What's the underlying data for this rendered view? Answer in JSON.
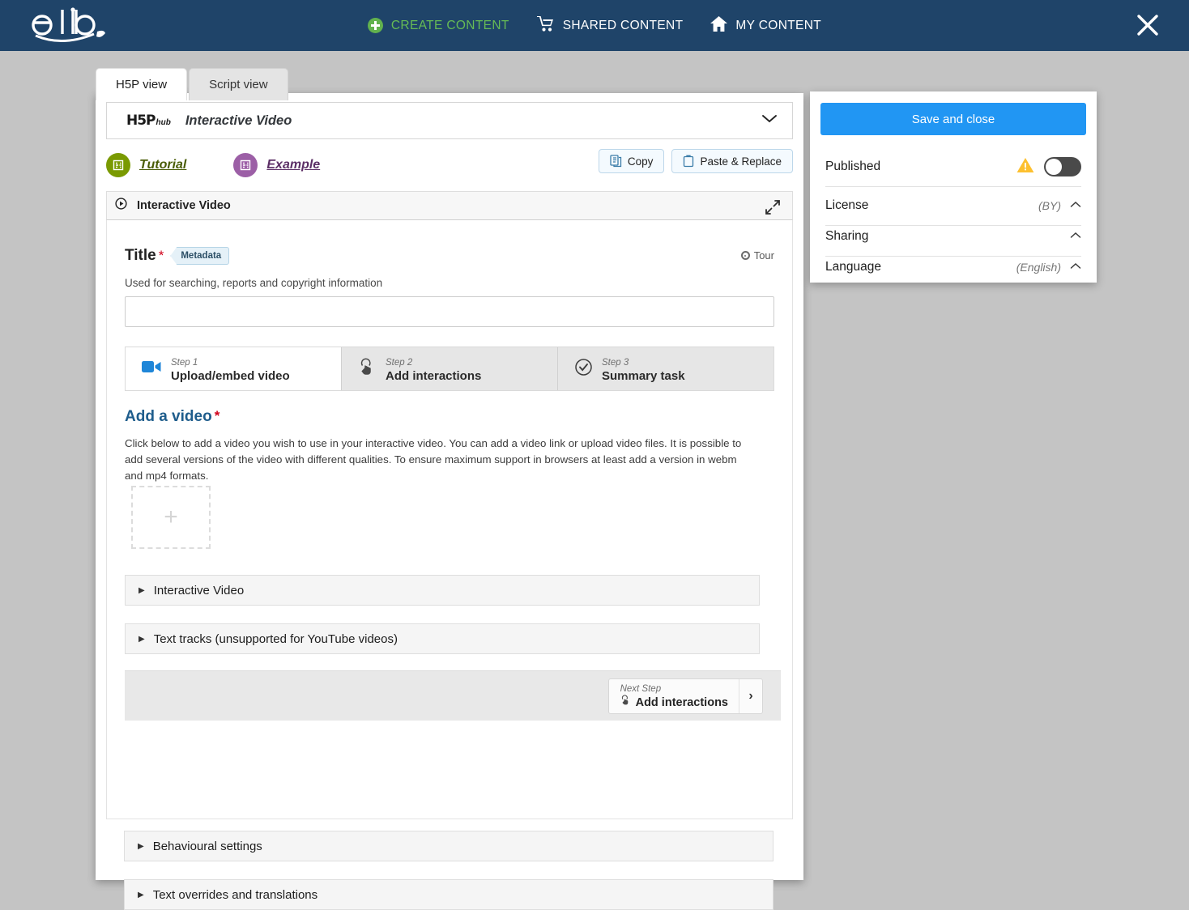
{
  "topbar": {
    "logo_text": "edlib",
    "nav": [
      {
        "label": "CREATE CONTENT",
        "icon": "plus-circle-icon"
      },
      {
        "label": "SHARED CONTENT",
        "icon": "shopping-cart-icon"
      },
      {
        "label": "MY CONTENT",
        "icon": "home-icon"
      }
    ],
    "close_label": "close-icon"
  },
  "tabs": [
    {
      "label": "H5P view",
      "active": true
    },
    {
      "label": "Script view",
      "active": false
    }
  ],
  "hub": {
    "logo_mark": "H5P",
    "logo_sub": "hub",
    "content_type": "Interactive Video",
    "chevron": "chevron-down-icon"
  },
  "links": [
    {
      "label": "Tutorial",
      "badge": "EQ·BE"
    },
    {
      "label": "Example",
      "badge": "EQ·3D"
    }
  ],
  "clipboard": {
    "copy_label": "Copy",
    "paste_label": "Paste & Replace"
  },
  "editor_header": {
    "title": "Interactive Video",
    "expand_icon": "expand-arrows-icon"
  },
  "title_field": {
    "label": "Title",
    "required_mark": "*",
    "metadata_pill": "Metadata",
    "tour_label": "Tour",
    "help": "Used for searching, reports and copyright information",
    "value": "",
    "placeholder": ""
  },
  "steps": [
    {
      "number": "Step 1",
      "name": "Upload/embed video",
      "icon": "video-camera-icon",
      "active": true
    },
    {
      "number": "Step 2",
      "name": "Add interactions",
      "icon": "hand-pointer-icon",
      "active": false
    },
    {
      "number": "Step 3",
      "name": "Summary task",
      "icon": "check-circle-icon",
      "active": false
    }
  ],
  "add_video": {
    "heading": "Add a video",
    "required_mark": "*",
    "description": "Click below to add a video you wish to use in your interactive video. You can add a video link or upload video files. It is possible to add several versions of the video with different qualities. To ensure maximum support in browsers at least add a version in webm and mp4 formats.",
    "dropzone_plus": "+"
  },
  "inner_accordions": [
    {
      "label": "Interactive Video"
    },
    {
      "label": "Text tracks (unsupported for YouTube videos)"
    }
  ],
  "next_step": {
    "caption": "Next Step",
    "action": "Add interactions",
    "arrow": "chevron-right-icon"
  },
  "outer_accordions": [
    {
      "label": "Behavioural settings"
    },
    {
      "label": "Text overrides and translations"
    }
  ],
  "side_panel": {
    "save_label": "Save and close",
    "rows": [
      {
        "label": "Published",
        "value": "",
        "control": "toggle-off",
        "warning": true
      },
      {
        "label": "License",
        "value": "(BY)",
        "control": "chevron-up"
      },
      {
        "label": "Sharing",
        "value": "",
        "control": "chevron-up"
      },
      {
        "label": "Language",
        "value": "(English)",
        "control": "chevron-up"
      }
    ]
  },
  "colors": {
    "topbar": "#1f4469",
    "accent_green": "#62b24e",
    "primary_blue": "#2196f3",
    "heading_blue": "#1f5d8c",
    "tutorial_green": "#7a9a01",
    "example_purple": "#9c5fa6",
    "required_red": "#d0021b",
    "warning_yellow": "#fdc02f",
    "page_bg": "#c4c4c4"
  }
}
